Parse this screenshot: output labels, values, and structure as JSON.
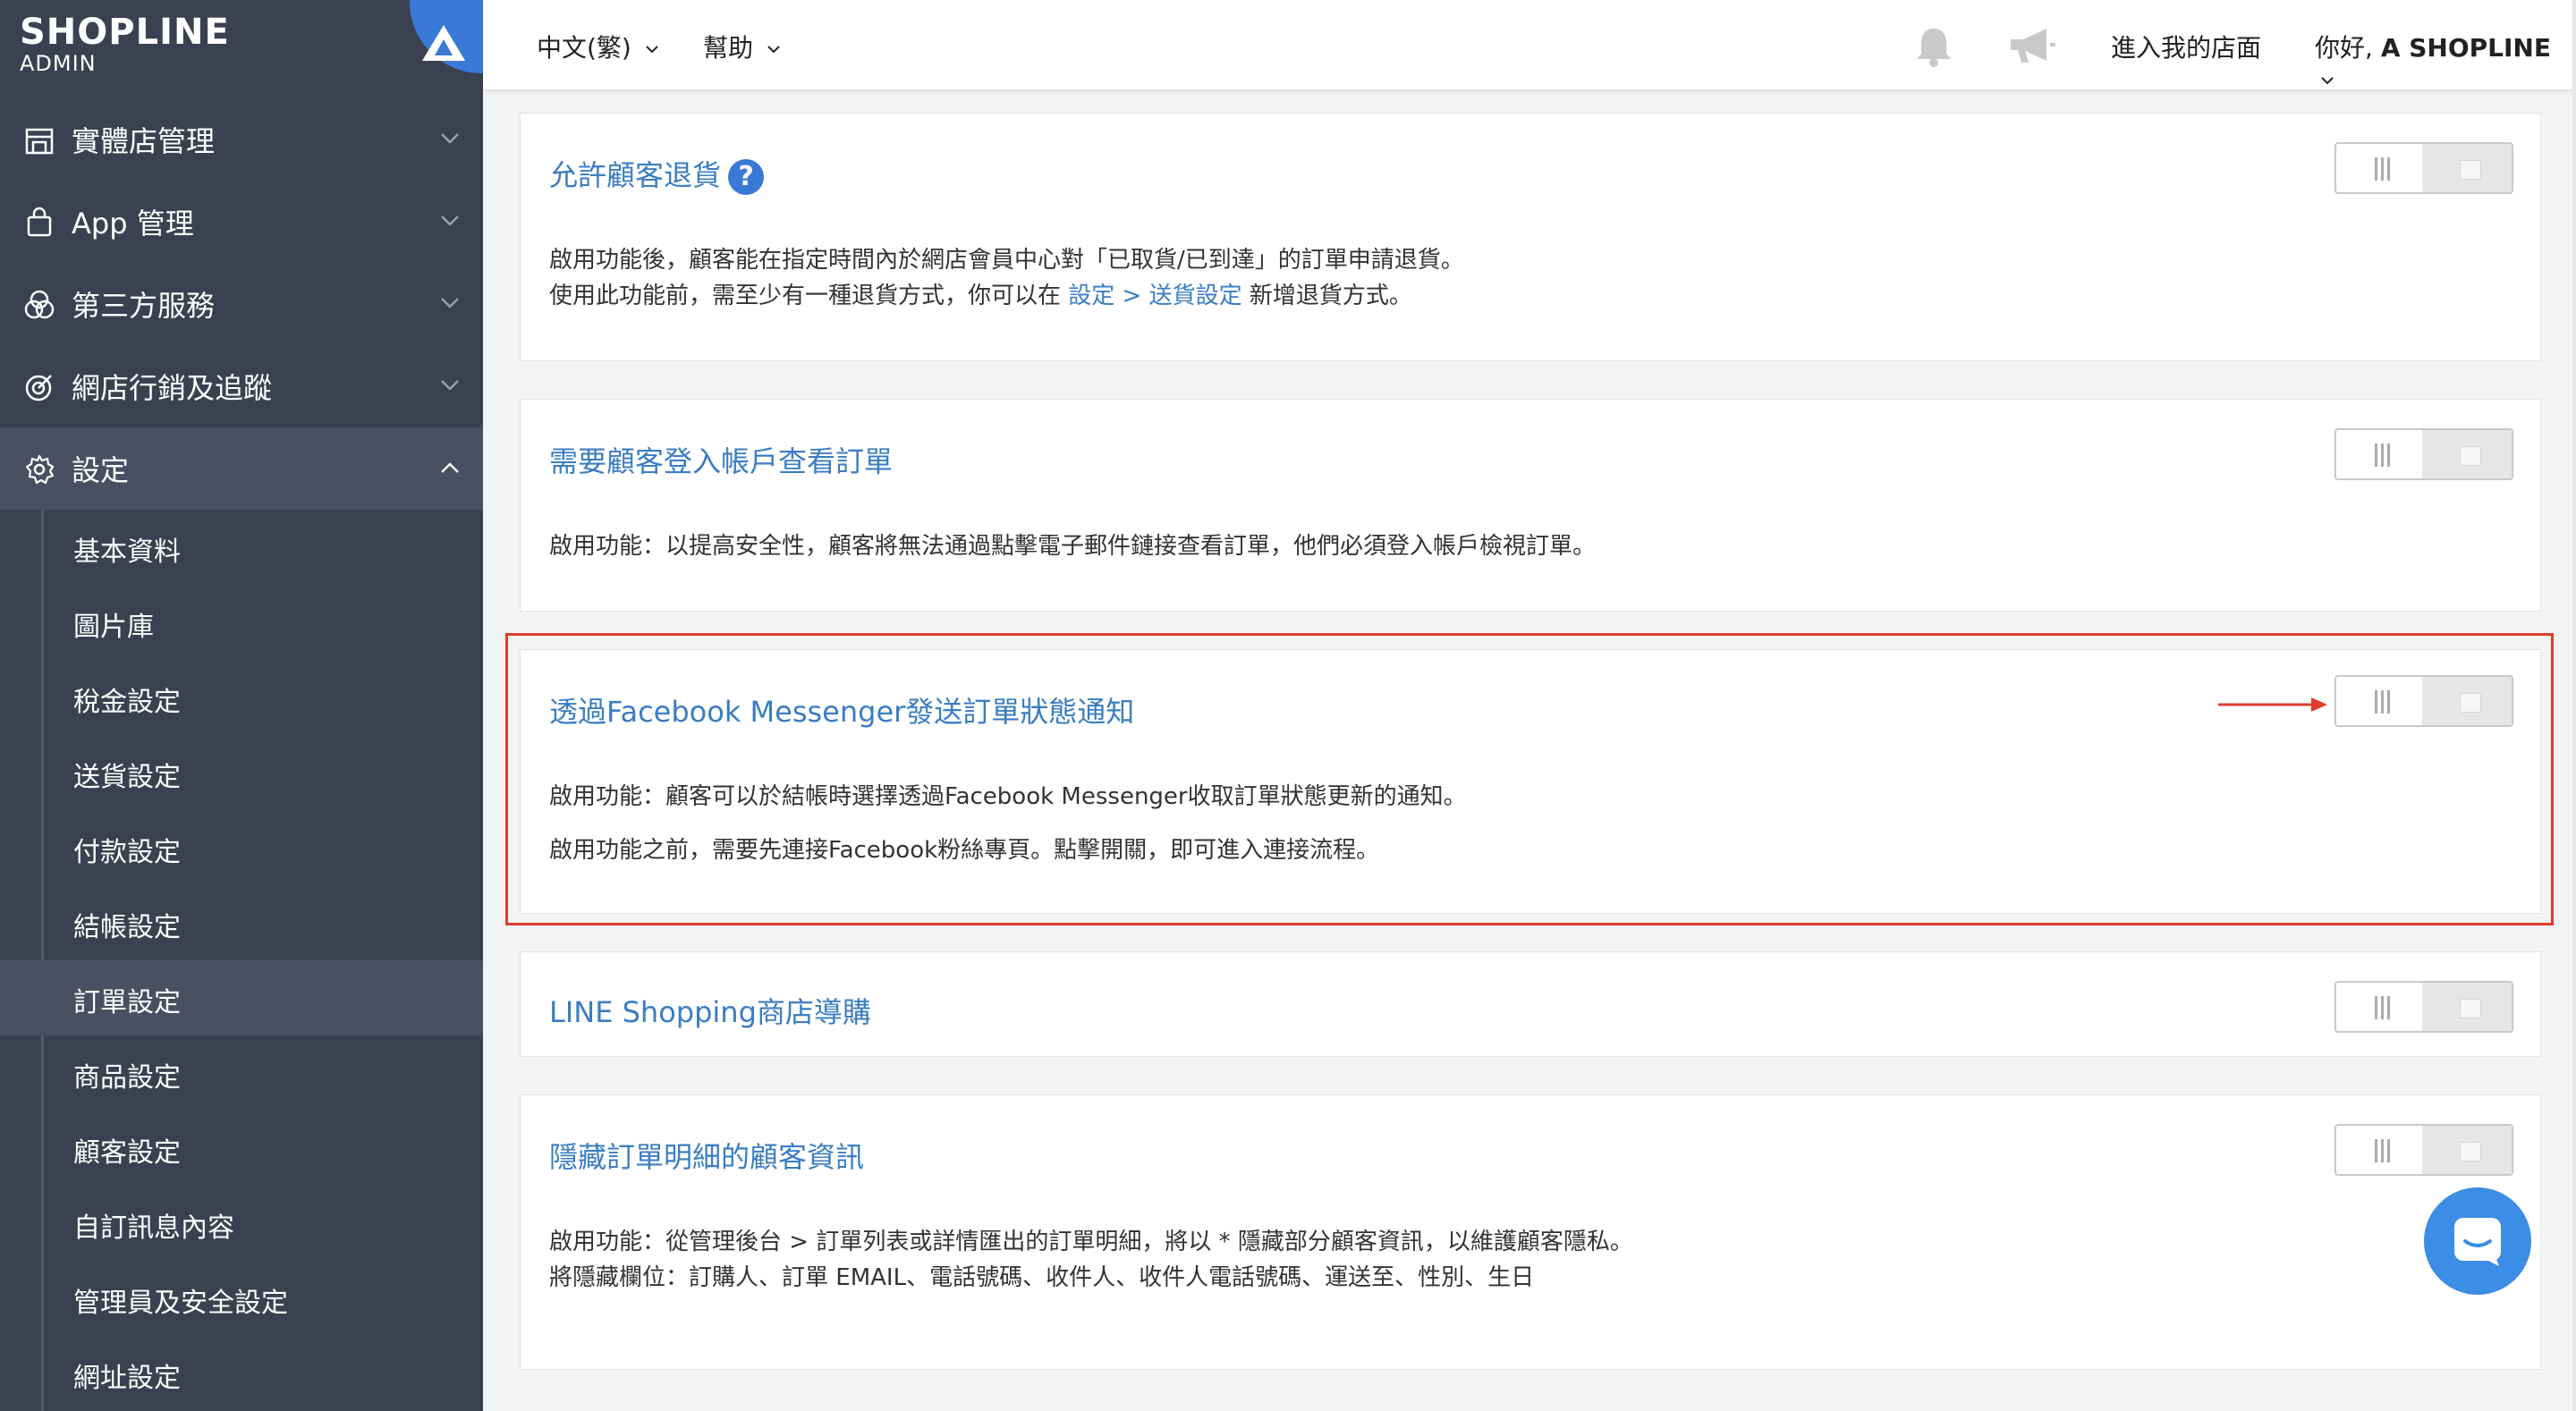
{
  "brand": {
    "logo_text": "SHOPLINE",
    "logo_sub": "ADMIN"
  },
  "sidebar": {
    "items": [
      {
        "label": "實體店管理",
        "icon": "store-icon"
      },
      {
        "label": "App 管理",
        "icon": "shopping-bag-icon"
      },
      {
        "label": "第三方服務",
        "icon": "venn-circles-icon"
      },
      {
        "label": "網店行銷及追蹤",
        "icon": "target-icon"
      },
      {
        "label": "設定",
        "icon": "gear-icon"
      }
    ],
    "sub_items": [
      {
        "label": "基本資料"
      },
      {
        "label": "圖片庫"
      },
      {
        "label": "稅金設定"
      },
      {
        "label": "送貨設定"
      },
      {
        "label": "付款設定"
      },
      {
        "label": "結帳設定"
      },
      {
        "label": "訂單設定"
      },
      {
        "label": "商品設定"
      },
      {
        "label": "顧客設定"
      },
      {
        "label": "自訂訊息內容"
      },
      {
        "label": "管理員及安全設定"
      },
      {
        "label": "網址設定"
      }
    ]
  },
  "topbar": {
    "language": "中文(繁)",
    "help": "幫助",
    "enter_store": "進入我的店面",
    "greeting": "你好,",
    "user": "A SHOPLINE"
  },
  "cards": [
    {
      "title": "允許顧客退貨",
      "desc1": "啟用功能後，顧客能在指定時間內於網店會員中心對「已取貨/已到達」的訂單申請退貨。",
      "desc2_pre": "使用此功能前，需至少有一種退貨方式，你可以在",
      "desc2_link": "設定 > 送貨設定",
      "desc2_post": "新增退貨方式。",
      "toggle_on": false
    },
    {
      "title": "需要顧客登入帳戶查看訂單",
      "desc1": "啟用功能：以提高安全性，顧客將無法通過點擊電子郵件鏈接查看訂單，他們必須登入帳戶檢視訂單。",
      "toggle_on": false
    },
    {
      "title": "透過Facebook Messenger發送訂單狀態通知",
      "desc1": "啟用功能：顧客可以於結帳時選擇透過Facebook Messenger收取訂單狀態更新的通知。",
      "desc2": "啟用功能之前，需要先連接Facebook粉絲專頁。點擊開關，即可進入連接流程。",
      "toggle_on": false
    },
    {
      "title": "LINE Shopping商店導購",
      "toggle_on": false
    },
    {
      "title": "隱藏訂單明細的顧客資訊",
      "desc1": "啟用功能：從管理後台 > 訂單列表或詳情匯出的訂單明細，將以 * 隱藏部分顧客資訊，以維護顧客隱私。",
      "desc2": "將隱藏欄位：訂購人、訂單 EMAIL、電話號碼、收件人、收件人電話號碼、運送至、性別、生日",
      "toggle_on": false
    }
  ],
  "colors": {
    "sidebar_bg": "#3b4150",
    "link": "#3a7dc2",
    "highlight": "#e03c2b",
    "accent": "#3a79d6"
  }
}
